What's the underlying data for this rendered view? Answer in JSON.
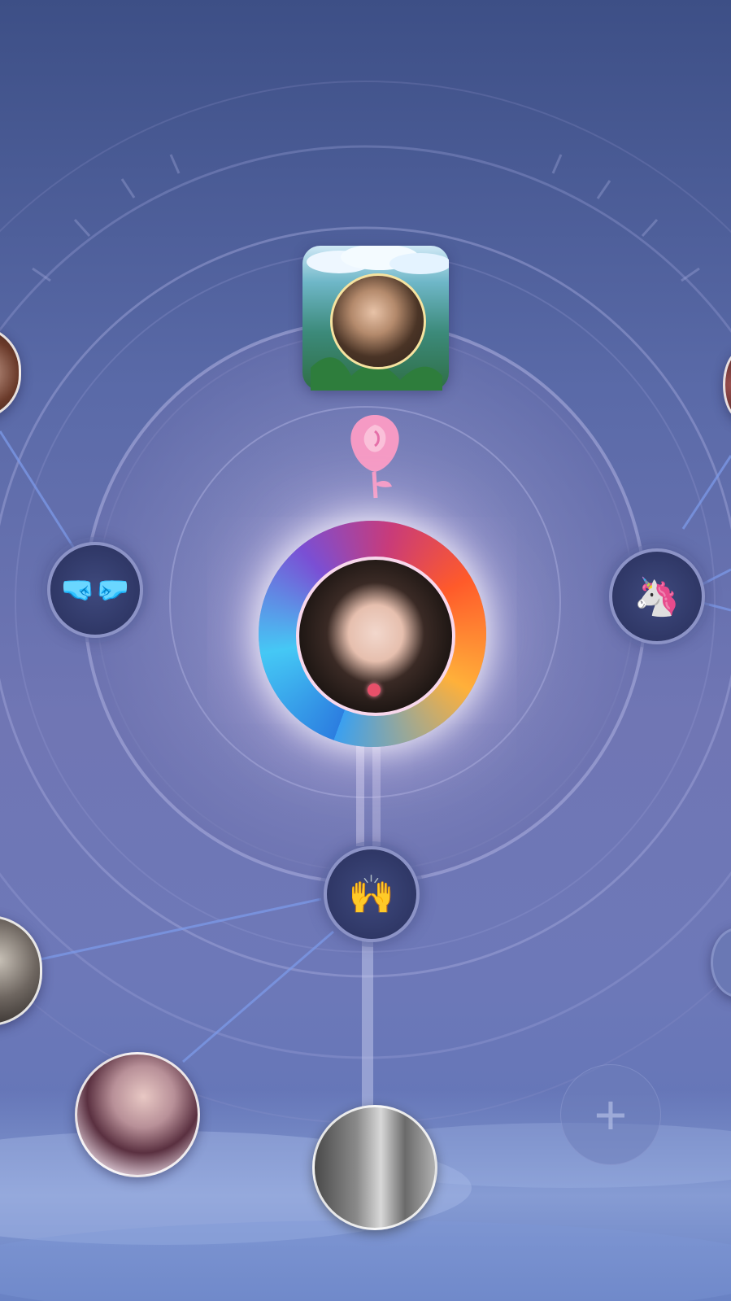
{
  "screen": {
    "type": "friend-relationship-network"
  },
  "center_avatar": {
    "frame": "fire-and-water-frame",
    "badge": "rose-icon"
  },
  "top_avatar": {
    "frame": "forest-cloud-frame"
  },
  "relationship_nodes": [
    {
      "id": "fist-bump",
      "icon": "fist-bump-icon",
      "glyph": "🤜🤛"
    },
    {
      "id": "unicorn",
      "icon": "unicorn-icon",
      "glyph": "🦄"
    },
    {
      "id": "high-five",
      "icon": "high-five-icon",
      "glyph": "🙌"
    }
  ],
  "friends": [
    {
      "id": "friend-top-left"
    },
    {
      "id": "friend-mid-left"
    },
    {
      "id": "friend-bottom-left"
    },
    {
      "id": "friend-bottom-center"
    },
    {
      "id": "friend-top-right"
    },
    {
      "id": "friend-mid-right"
    }
  ],
  "add_button": {
    "label": "+"
  },
  "colors": {
    "background_top": "#3d4f86",
    "background_bottom": "#5a74b8",
    "node_fill": "#2f3766",
    "node_ring": "#8c93c6",
    "rose": "#f59ac4",
    "unicorn": "#f5a3d6",
    "fist": "#7fd6ff",
    "hands": "#ffd98a"
  }
}
